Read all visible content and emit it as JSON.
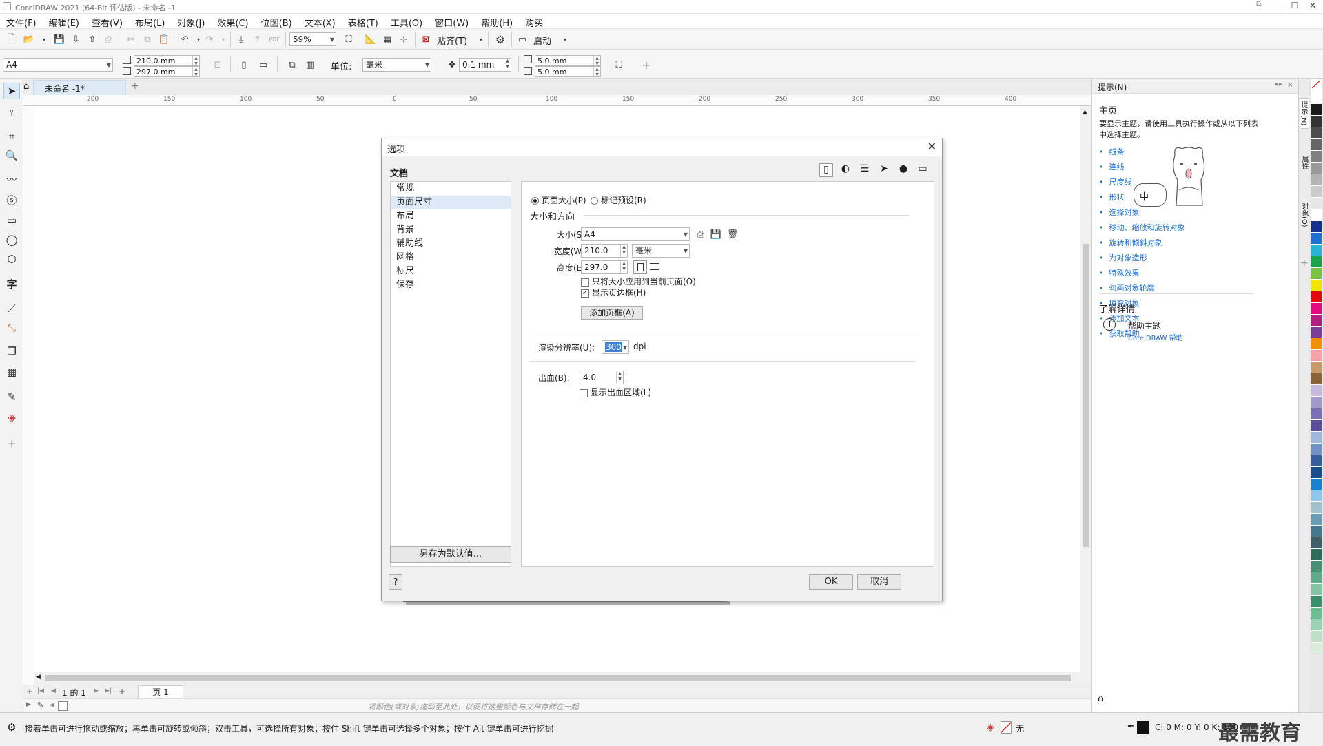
{
  "window": {
    "title": "CorelDRAW 2021 (64-Bit 评估版) - 未命名 -1"
  },
  "menu": [
    "文件(F)",
    "编辑(E)",
    "查看(V)",
    "布局(L)",
    "对象(J)",
    "效果(C)",
    "位图(B)",
    "文本(X)",
    "表格(T)",
    "工具(O)",
    "窗口(W)",
    "帮助(H)",
    "购买"
  ],
  "toolbar1": {
    "zoom": "59%",
    "snap_label": "贴齐(T)",
    "launch_label": "启动"
  },
  "toolbar2": {
    "page_size": "A4",
    "width": "210.0 mm",
    "height": "297.0 mm",
    "unit_label": "单位:",
    "unit": "毫米",
    "nudge": "0.1 mm",
    "dup_x": "5.0 mm",
    "dup_y": "5.0 mm"
  },
  "doc_tab": "未命名 -1*",
  "ruler_ticks": [
    "200",
    "150",
    "100",
    "50",
    "0",
    "50",
    "100",
    "150",
    "200",
    "250",
    "300",
    "350",
    "400"
  ],
  "dialog": {
    "title": "选项",
    "section": "文档",
    "nav": [
      "常规",
      "页面尺寸",
      "布局",
      "背景",
      "辅助线",
      "网格",
      "标尺",
      "保存"
    ],
    "nav_selected": 1,
    "save_default": "另存为默认值...",
    "help": "?",
    "ok": "OK",
    "cancel": "取消",
    "radio_page_size": "页面大小(P)",
    "radio_label_preset": "标记预设(R)",
    "group_size": "大小和方向",
    "size_label": "大小(S):",
    "size_value": "A4",
    "width_label": "宽度(W):",
    "width_value": "210.0",
    "unit_value": "毫米",
    "height_label": "高度(E):",
    "height_value": "297.0",
    "only_current": "只将大小应用到当前页面(O)",
    "show_border": "显示页边框(H)",
    "add_frame": "添加页框(A)",
    "render_label": "渲染分辨率(U):",
    "render_value": "300",
    "render_unit": "dpi",
    "bleed_label": "出血(B):",
    "bleed_value": "4.0",
    "show_bleed": "显示出血区域(L)"
  },
  "hints": {
    "header": "提示(N)",
    "home": "主页",
    "intro": "要显示主题，请使用工具执行操作或从以下列表中选择主题。",
    "links": [
      "线条",
      "连线",
      "尺度线",
      "形状",
      "选择对象",
      "移动、缩放和旋转对象",
      "旋转和倾斜对象",
      "为对象造形",
      "特殊效果",
      "勾画对象轮廓",
      "填充对象",
      "添加文本",
      "获取帮助"
    ],
    "more": "了解详情",
    "help_topic": "帮助主题",
    "help_link": "CorelDRAW 帮助",
    "mascot_text": "中"
  },
  "sidetabs": [
    "提示(N)",
    "属性",
    "对象(O)"
  ],
  "pagebar": {
    "page_count": "1 的 1",
    "page_tab": "页 1"
  },
  "colorbar_hint": "将颜色(或对象)拖动至此处，以便将这些颜色与文档存储在一起",
  "status": {
    "text": "接着单击可进行拖动或缩放；再单击可旋转或倾斜；双击工具，可选择所有对象；按住 Shift 键单击可选择多个对象；按住 Alt 键单击可进行挖掘",
    "fill_none": "无",
    "cmyk": "C: 0 M: 0 Y: 0 K: 100"
  },
  "watermark": "最需教育",
  "palette": [
    "#ffffff",
    "#1a1a1a",
    "#333333",
    "#4d4d4d",
    "#666666",
    "#808080",
    "#999999",
    "#b3b3b3",
    "#cccccc",
    "#e6e6e6",
    "#ffffff",
    "#17328a",
    "#1e6fd0",
    "#2bb3d6",
    "#1aa34a",
    "#7cc242",
    "#f2e500",
    "#e30613",
    "#e5097f",
    "#b01f7e",
    "#7b3f98",
    "#f39200",
    "#f4a3a8",
    "#c79a6b",
    "#8c6239",
    "#c9b9dd",
    "#a49ac9",
    "#7a6fb1",
    "#5b4f9a",
    "#9fb7d9",
    "#6f93c4",
    "#355f9b",
    "#1a4e8b",
    "#1c80c8",
    "#8ec5e8",
    "#a2c1cf",
    "#6a9db3",
    "#44798d",
    "#3f5f6b",
    "#2f6b5a",
    "#4a8e73",
    "#62a98a",
    "#86c3a2",
    "#3b8f6a",
    "#6cbf95",
    "#9cd1b6",
    "#bfe0c7",
    "#d9ecd9"
  ]
}
